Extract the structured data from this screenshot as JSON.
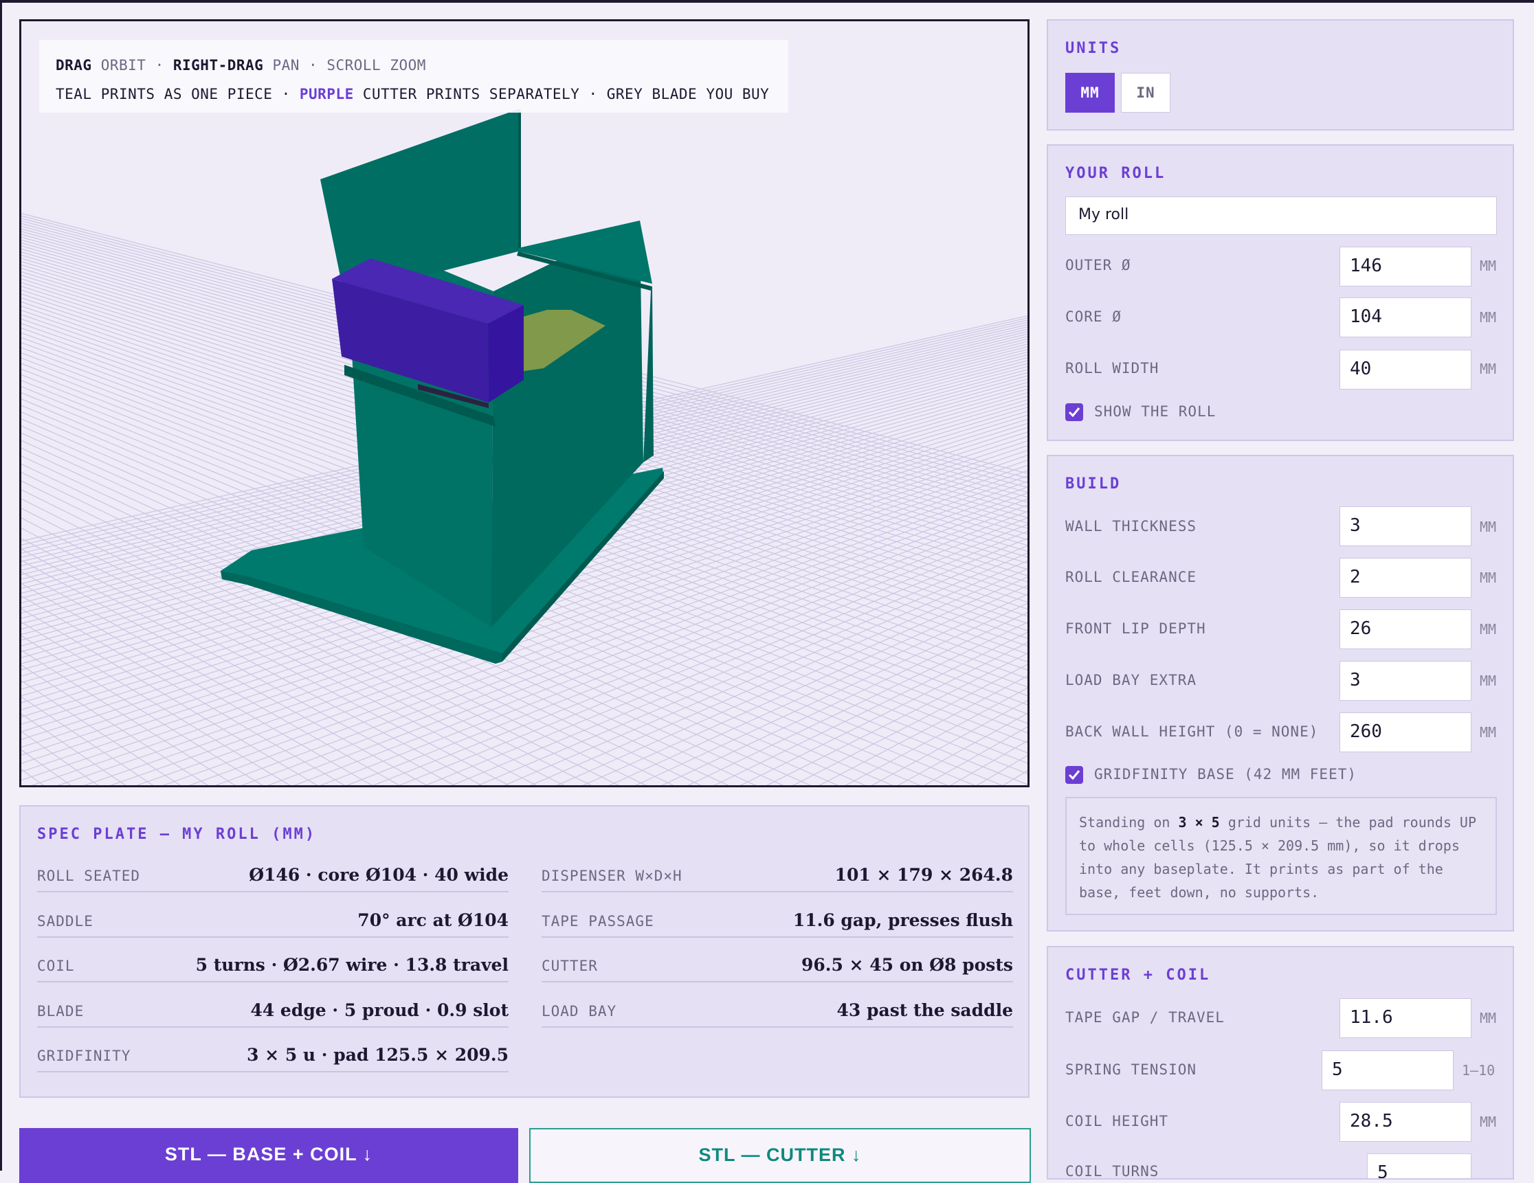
{
  "viewport": {
    "hint_line1": [
      {
        "text": "DRAG",
        "style": "k"
      },
      {
        "text": " ORBIT · ",
        "style": "m"
      },
      {
        "text": "RIGHT-DRAG",
        "style": "k"
      },
      {
        "text": " PAN · SCROLL ZOOM",
        "style": "m"
      }
    ],
    "hint_line2": [
      {
        "text": "TEAL PRINTS AS ONE PIECE · ",
        "style": ""
      },
      {
        "text": "PURPLE",
        "style": "p"
      },
      {
        "text": " CUTTER PRINTS SEPARATELY · GREY BLADE YOU BUY",
        "style": ""
      }
    ],
    "colors": {
      "teal": "#006e63",
      "purple": "#3e1ba4",
      "grid": "#cdc7e3",
      "roll": "#9aa64a"
    }
  },
  "units": {
    "title": "UNITS",
    "options": [
      "MM",
      "IN"
    ],
    "selected": "MM"
  },
  "roll": {
    "title": "YOUR ROLL",
    "name_value": "My roll",
    "fields": [
      {
        "label": "OUTER Ø",
        "value": "146",
        "unit": "MM"
      },
      {
        "label": "CORE Ø",
        "value": "104",
        "unit": "MM"
      },
      {
        "label": "ROLL WIDTH",
        "value": "40",
        "unit": "MM"
      }
    ],
    "show_roll_label": "SHOW THE ROLL",
    "show_roll_checked": true
  },
  "build": {
    "title": "BUILD",
    "fields": [
      {
        "label": "WALL THICKNESS",
        "value": "3",
        "unit": "MM"
      },
      {
        "label": "ROLL CLEARANCE",
        "value": "2",
        "unit": "MM"
      },
      {
        "label": "FRONT LIP DEPTH",
        "value": "26",
        "unit": "MM"
      },
      {
        "label": "LOAD BAY EXTRA",
        "value": "3",
        "unit": "MM"
      },
      {
        "label": "BACK WALL HEIGHT (0 = NONE)",
        "value": "260",
        "unit": "MM"
      }
    ],
    "gridfinity_label": "GRIDFINITY BASE (42 MM FEET)",
    "gridfinity_checked": true,
    "note_pre": "Standing on ",
    "note_bold": "3 × 5",
    "note_post": " grid units — the pad rounds UP to whole cells (125.5 × 209.5 mm), so it drops into any baseplate. It prints as part of the base, feet down, no supports."
  },
  "cutter": {
    "title": "CUTTER + COIL",
    "fields": [
      {
        "label": "TAPE GAP / TRAVEL",
        "value": "11.6",
        "unit": "MM"
      },
      {
        "label": "SPRING TENSION",
        "value": "5",
        "unit": "1–10"
      },
      {
        "label": "COIL HEIGHT",
        "value": "28.5",
        "unit": "MM"
      },
      {
        "label": "COIL TURNS",
        "value": "5",
        "unit": ""
      }
    ]
  },
  "spec": {
    "title": "SPEC PLATE — MY ROLL (MM)",
    "left": [
      {
        "label": "ROLL SEATED",
        "value": "Ø146 · core Ø104 · 40 wide"
      },
      {
        "label": "SADDLE",
        "value": "70° arc at Ø104"
      },
      {
        "label": "COIL",
        "value": "5 turns · Ø2.67 wire · 13.8 travel"
      },
      {
        "label": "BLADE",
        "value": "44 edge · 5 proud · 0.9 slot"
      },
      {
        "label": "GRIDFINITY",
        "value": "3 × 5 u · pad 125.5 × 209.5"
      }
    ],
    "right": [
      {
        "label": "DISPENSER W×D×H",
        "value": "101 × 179 × 264.8"
      },
      {
        "label": "TAPE PASSAGE",
        "value": "11.6 gap, presses flush"
      },
      {
        "label": "CUTTER",
        "value": "96.5 × 45 on Ø8 posts"
      },
      {
        "label": "LOAD BAY",
        "value": "43 past the saddle"
      }
    ]
  },
  "downloads": {
    "base_label": "STL — BASE + COIL ↓",
    "cutter_label": "STL — CUTTER ↓"
  }
}
